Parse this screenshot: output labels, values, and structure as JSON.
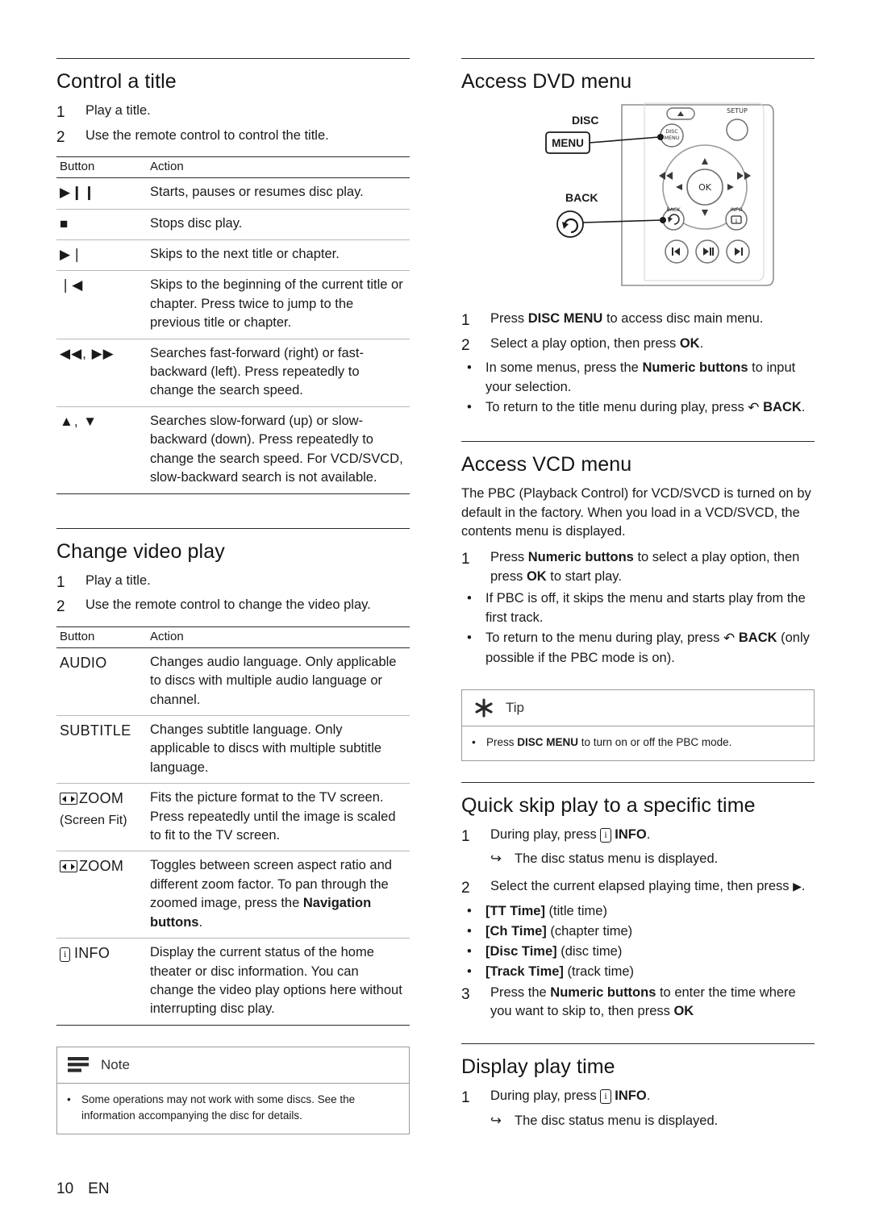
{
  "page": {
    "number": "10",
    "lang": "EN"
  },
  "left": {
    "s1": {
      "title": "Control a title",
      "steps": [
        {
          "num": "1",
          "text": "Play a title."
        },
        {
          "num": "2",
          "text": "Use the remote control to control the title."
        }
      ],
      "table": {
        "headers": [
          "Button",
          "Action"
        ],
        "rows": [
          {
            "button": "▶❙❙",
            "action": "Starts, pauses or resumes disc play."
          },
          {
            "button": "■",
            "action": "Stops disc play."
          },
          {
            "button": "▶❘",
            "action": "Skips to the next title or chapter."
          },
          {
            "button": "❘◀",
            "action": "Skips to the beginning of the current title or chapter. Press twice to jump to the previous title or chapter."
          },
          {
            "button": "◀◀, ▶▶",
            "action": "Searches fast-forward (right) or fast-backward (left). Press repeatedly to change the search speed."
          },
          {
            "button": "▲, ▼",
            "action": "Searches slow-forward (up) or slow-backward (down). Press repeatedly to change the search speed. For VCD/SVCD, slow-backward search is not available."
          }
        ]
      }
    },
    "s2": {
      "title": "Change video play",
      "steps": [
        {
          "num": "1",
          "text": "Play a title."
        },
        {
          "num": "2",
          "text": "Use the remote control to change the video play."
        }
      ],
      "table": {
        "headers": [
          "Button",
          "Action"
        ],
        "rows": [
          {
            "button": "AUDIO",
            "button_sub": "",
            "action": "Changes audio language. Only applicable to discs with multiple audio language or channel."
          },
          {
            "button": "SUBTITLE",
            "button_sub": "",
            "action": "Changes subtitle language. Only applicable to discs with multiple subtitle language."
          },
          {
            "button": "ZOOM",
            "button_sub": "(Screen Fit)",
            "action": "Fits the picture format to the TV screen. Press repeatedly until the image is scaled to fit to the TV screen."
          },
          {
            "button": "ZOOM",
            "button_sub": "",
            "action": "Toggles between screen aspect ratio and different zoom factor. To pan through the zoomed image, press the Navigation buttons."
          },
          {
            "button": "INFO",
            "button_sub": "",
            "action": "Display the current status of the home theater or disc information. You can change the video play options here without interrupting disc play."
          }
        ]
      }
    },
    "note": {
      "label": "Note",
      "items": [
        "Some operations may not work with some discs. See the information accompanying the disc for details."
      ]
    }
  },
  "right": {
    "s1": {
      "title": "Access DVD menu",
      "remote_labels": {
        "disc": "DISC",
        "menu": "MENU",
        "back": "BACK",
        "setup": "SETUP",
        "ok": "OK",
        "small_disc": "DISC",
        "small_menu": "MENU",
        "small_back": "BACK",
        "small_info": "INFO"
      },
      "steps": [
        {
          "num": "1",
          "text_pre": "Press ",
          "bold": "DISC MENU",
          "text_post": " to access disc main menu."
        },
        {
          "num": "2",
          "text_pre": "Select a play option, then press ",
          "bold": "OK",
          "text_post": "."
        }
      ],
      "bullets": [
        {
          "pre": "In some menus, press the ",
          "b1": "Numeric buttons",
          "post": " to input your selection."
        },
        {
          "pre": "To return to the title menu during play, press ",
          "b1": "BACK",
          "post": "."
        }
      ]
    },
    "s2": {
      "title": "Access VCD menu",
      "para": "The PBC (Playback Control) for VCD/SVCD is turned on by default in the factory. When you load in a VCD/SVCD, the contents menu is displayed.",
      "steps": [
        {
          "num": "1",
          "text_pre": "Press ",
          "bold": "Numeric buttons",
          "text_mid": " to select a play option, then press ",
          "bold2": "OK",
          "text_post": " to start play."
        }
      ],
      "bullets": [
        {
          "pre": "If PBC is off, it skips the menu and starts play from the first track.",
          "b1": "",
          "post": ""
        },
        {
          "pre": "To return to the menu during play, press ",
          "b1": "BACK",
          "post": " (only possible if the PBC mode is on)."
        }
      ],
      "tip": {
        "label": "Tip",
        "items": [
          {
            "pre": "Press ",
            "b1": "DISC MENU",
            "post": " to turn on or off the PBC mode."
          }
        ]
      }
    },
    "s3": {
      "title": "Quick skip play to a specific time",
      "steps": [
        {
          "num": "1",
          "text_pre": "During play, press ",
          "bold": "INFO",
          "text_post": "."
        },
        {
          "num": "2",
          "text_pre": "Select the current elapsed playing time, then press ",
          "bold": "",
          "text_post": "."
        },
        {
          "num": "3",
          "text_pre": "Press the ",
          "bold": "Numeric buttons",
          "text_post": " to enter the time where you want to skip to, then press ",
          "bold2": "OK"
        }
      ],
      "arrow_note": "The disc status menu is displayed.",
      "time_options": [
        {
          "b": "[TT Time]",
          "t": " (title time)"
        },
        {
          "b": "[Ch Time]",
          "t": " (chapter time)"
        },
        {
          "b": "[Disc Time]",
          "t": " (disc time)"
        },
        {
          "b": "[Track Time]",
          "t": " (track time)"
        }
      ]
    },
    "s4": {
      "title": "Display play time",
      "steps": [
        {
          "num": "1",
          "text_pre": "During play, press ",
          "bold": "INFO",
          "text_post": "."
        }
      ],
      "arrow_note": "The disc status menu is displayed."
    }
  }
}
